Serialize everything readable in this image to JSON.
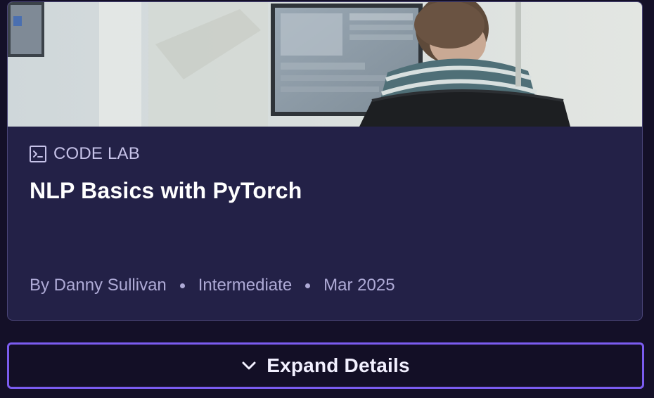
{
  "card": {
    "hero_image_icon": "person-at-computer-photo",
    "type_icon": "terminal-icon",
    "type_label": "CODE LAB",
    "title": "NLP Basics with PyTorch",
    "meta": {
      "author": "By Danny Sullivan",
      "level": "Intermediate",
      "date": "Mar 2025"
    }
  },
  "expand": {
    "icon": "chevron-down-icon",
    "label": "Expand Details"
  },
  "colors": {
    "background": "#141028",
    "card": "#232147",
    "accent": "#7b5cf0",
    "muted_text": "#aeaad6"
  }
}
